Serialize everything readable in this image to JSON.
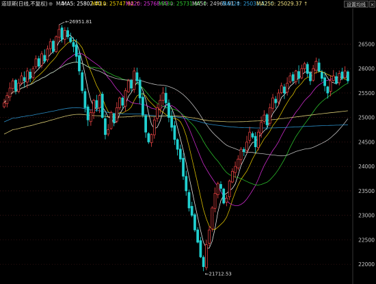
{
  "header": {
    "title": "道琼斯",
    "mode": "(日线,不复权)",
    "ind_toggle": "⊕",
    "ind_label": "MA",
    "ma": [
      {
        "label": "MA5:",
        "value": "25802.40",
        "arrow": "↓",
        "color": "#ffffff"
      },
      {
        "label": "MA10:",
        "value": "25747.92",
        "arrow": "↑",
        "color": "#f0d000"
      },
      {
        "label": "MA20:",
        "value": "25768.99",
        "arrow": "↓",
        "color": "#e030e0"
      },
      {
        "label": "MA30:",
        "value": "25731.97",
        "arrow": "↑",
        "color": "#30d030"
      },
      {
        "label": "MA50:",
        "value": "24965.91",
        "arrow": "↑",
        "color": "#d0d0d0"
      },
      {
        "label": "MA120:",
        "value": "25031.32",
        "arrow": "↑",
        "color": "#30a0e0"
      },
      {
        "label": "MA250:",
        "value": "25029.37",
        "arrow": "↑",
        "color": "#f0e080"
      }
    ],
    "settings_btn": "设置均线",
    "close_btn": "×"
  },
  "colors": {
    "up": "#e04040",
    "down": "#20d0d0",
    "axis_text": "#c8c8c8",
    "grid": "#5a2020"
  },
  "chart_data": {
    "type": "candlestick",
    "y_axis_ticks": [
      26500,
      26000,
      25500,
      25000,
      24500,
      24000,
      23500,
      23000,
      22500,
      22000
    ],
    "ylim": [
      21680,
      27150
    ],
    "annotations": [
      {
        "text": "26951.81",
        "kind": "high"
      },
      {
        "text": "21712.53",
        "kind": "low"
      }
    ],
    "closes": [
      25300,
      25450,
      25600,
      25750,
      25550,
      25700,
      25850,
      25750,
      25950,
      25800,
      26000,
      26200,
      26050,
      26300,
      26150,
      26400,
      26550,
      26350,
      26650,
      26800,
      26600,
      26780,
      26650,
      26550,
      26450,
      26250,
      25950,
      25550,
      25200,
      24950,
      25100,
      25350,
      25200,
      25450,
      25000,
      24650,
      24750,
      25100,
      24900,
      25200,
      25400,
      25250,
      25550,
      25750,
      25600,
      25950,
      25750,
      25400,
      25050,
      24700,
      24500,
      24650,
      24950,
      25200,
      25350,
      25500,
      25300,
      25000,
      24800,
      24550,
      24350,
      24150,
      23800,
      23500,
      23150,
      23000,
      22700,
      22450,
      22150,
      21950,
      22400,
      22700,
      23150,
      23450,
      23650,
      23550,
      23250,
      23350,
      23700,
      23900,
      24000,
      24150,
      24350,
      24300,
      24500,
      24700,
      24600,
      24400,
      24700,
      24900,
      25050,
      24850,
      25200,
      25400,
      25300,
      25500,
      25650,
      25500,
      25700,
      25850,
      25750,
      25950,
      25800,
      26000,
      26100,
      25900,
      25750,
      26000,
      26150,
      25950,
      25800,
      25650,
      25500,
      25750,
      25850,
      25700,
      25900,
      25800,
      25950,
      25750
    ]
  }
}
